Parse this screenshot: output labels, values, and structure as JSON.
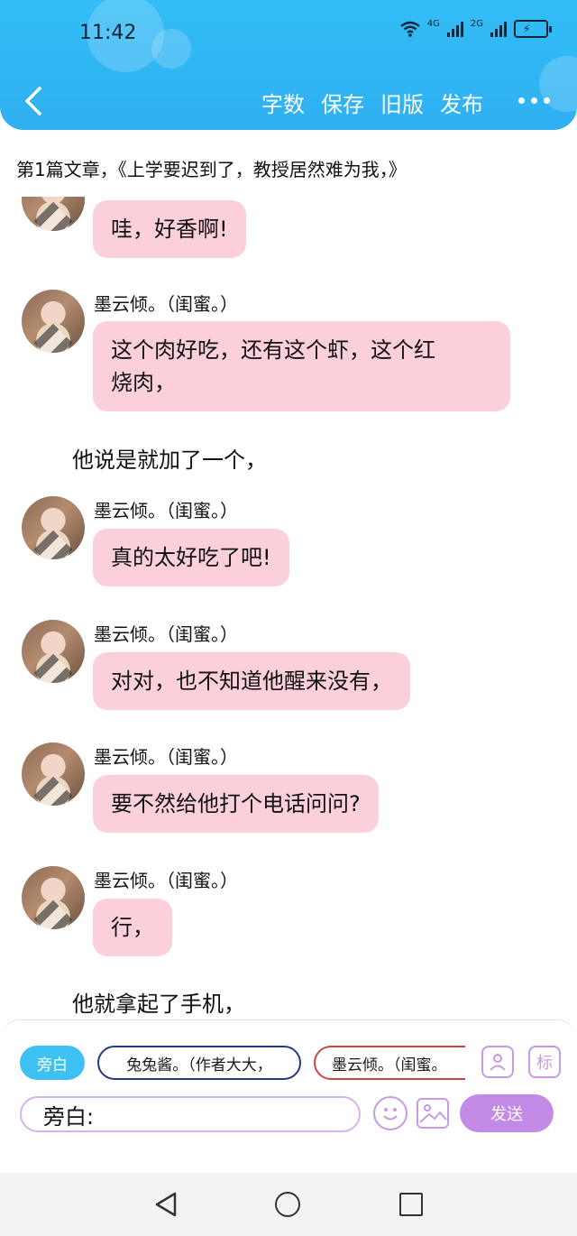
{
  "status": {
    "time": "11:42",
    "net1": "4G",
    "net2": "2G"
  },
  "toolbar": {
    "word_count": "字数",
    "save": "保存",
    "old_version": "旧版",
    "publish": "发布"
  },
  "article_title": "第1篇文章，《上学要迟到了，教授居然难为我，》",
  "messages": [
    {
      "type": "bubble",
      "speaker": "",
      "text": "哇，好香啊!"
    },
    {
      "type": "bubble",
      "speaker": "墨云倾。（闺蜜。）",
      "text_line1": "这个肉好吃，还有这个虾，这个红",
      "text_line2": "烧肉，"
    },
    {
      "type": "narration",
      "text": "他说是就加了一个，"
    },
    {
      "type": "bubble",
      "speaker": "墨云倾。（闺蜜。）",
      "text": "真的太好吃了吧!"
    },
    {
      "type": "bubble",
      "speaker": "墨云倾。（闺蜜。）",
      "text": "对对，也不知道他醒来没有，"
    },
    {
      "type": "bubble",
      "speaker": "墨云倾。（闺蜜。）",
      "text": "要不然给他打个电话问问?"
    },
    {
      "type": "bubble",
      "speaker": "墨云倾。（闺蜜。）",
      "text": "行，"
    },
    {
      "type": "narration",
      "text": "他就拿起了手机，"
    }
  ],
  "composer": {
    "role_narration": "旁白",
    "role_author": "兔兔酱。（作者大大，",
    "role_friend": "墨云倾。（闺蜜。",
    "input_value": "旁白:",
    "send_label": "发送",
    "tag_icon_char": "标"
  },
  "colors": {
    "header": "#33bdf6",
    "bubble": "#fbd0da",
    "accent_purple": "#c48be6",
    "narration_chip": "#3cc1f2"
  }
}
